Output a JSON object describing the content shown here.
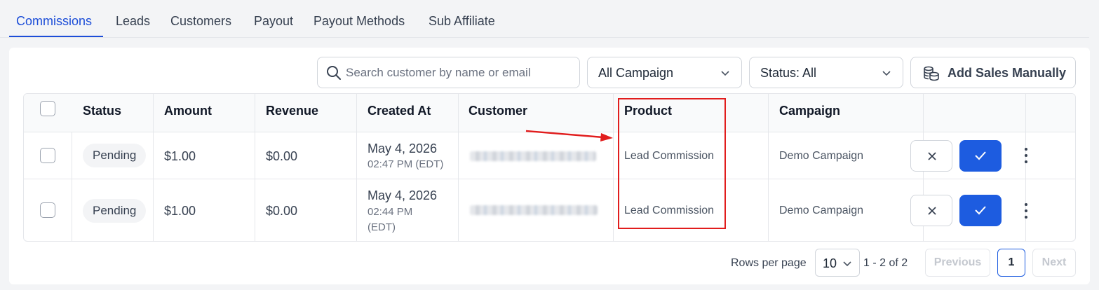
{
  "tabs": [
    {
      "label": "Commissions",
      "active": true
    },
    {
      "label": "Leads"
    },
    {
      "label": "Customers"
    },
    {
      "label": "Payout"
    },
    {
      "label": "Payout Methods"
    },
    {
      "label": "Sub Affiliate"
    }
  ],
  "toolbar": {
    "search_placeholder": "Search customer by name or email",
    "campaign_select": "All Campaign",
    "status_select": "Status: All",
    "add_sales_label": "Add Sales Manually"
  },
  "table": {
    "headers": [
      "Status",
      "Amount",
      "Revenue",
      "Created At",
      "Customer",
      "Product",
      "Campaign"
    ],
    "rows": [
      {
        "status": "Pending",
        "amount": "$1.00",
        "revenue": "$0.00",
        "created_date": "May 4, 2026",
        "created_time": "02:47 PM (EDT)",
        "customer": "",
        "product": "Lead Commission",
        "campaign": "Demo Campaign"
      },
      {
        "status": "Pending",
        "amount": "$1.00",
        "revenue": "$0.00",
        "created_date": "May 4, 2026",
        "created_time_line1": "02:44 PM",
        "created_time_line2": "(EDT)",
        "customer": "",
        "product": "Lead Commission",
        "campaign": "Demo Campaign"
      }
    ]
  },
  "pagination": {
    "rows_per_page_label": "Rows per page",
    "rows_per_page": "10",
    "range": "1 - 2 of 2",
    "previous": "Previous",
    "current_page": "1",
    "next": "Next"
  },
  "colors": {
    "accent": "#1d5ce0",
    "annotation": "#e11d1d"
  },
  "icons": [
    "search-icon",
    "chevron-down-icon",
    "coins-icon",
    "close-icon",
    "check-icon",
    "more-vertical-icon",
    "annotation-arrow-icon"
  ]
}
